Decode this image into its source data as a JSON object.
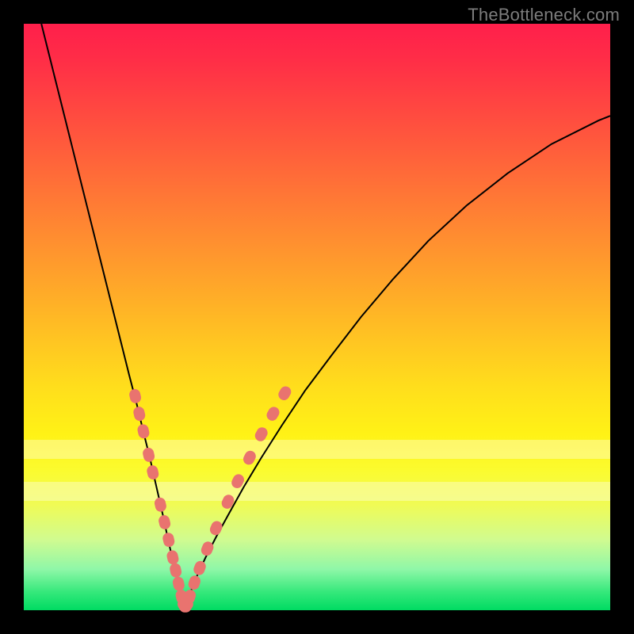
{
  "watermark": "TheBottleneck.com",
  "colors": {
    "bead": "#e9736f",
    "curve": "#000000",
    "frame": "#000000"
  },
  "chart_data": {
    "type": "line",
    "title": "",
    "xlabel": "",
    "ylabel": "",
    "xlim": [
      0,
      100
    ],
    "ylim": [
      0,
      100
    ],
    "grid": false,
    "legend": false,
    "note": "Two black curves forming a V-minimum over a vertical red→yellow→green gradient. Salmon beads mark where each curve passes through the pale band near the bottom. Values are approximate pixel-to-percent readings off the 740×740 plot area (0,0 at bottom-left).",
    "series": [
      {
        "name": "left-curve",
        "x": [
          3,
          5,
          7,
          9,
          11,
          13,
          15,
          16.5,
          18,
          19.3,
          20.5,
          21.5,
          22.4,
          23.2,
          24,
          24.6,
          25.2,
          25.7,
          26.1,
          26.4,
          26.7,
          26.95,
          27.15,
          27.3,
          27.4
        ],
        "y": [
          100,
          92,
          84,
          76,
          68,
          60,
          52,
          46,
          40,
          35,
          30,
          26,
          22,
          18.5,
          15,
          12,
          9.5,
          7.3,
          5.5,
          4,
          2.8,
          1.8,
          1.1,
          0.5,
          0.1
        ]
      },
      {
        "name": "right-curve",
        "x": [
          27.4,
          27.9,
          28.6,
          29.6,
          31,
          32.8,
          35,
          37.5,
          40.5,
          44,
          48,
          52.5,
          57.5,
          63,
          69,
          75.5,
          82.5,
          90,
          98,
          100
        ],
        "y": [
          0.1,
          1.5,
          3.5,
          6,
          9,
          12.5,
          16.5,
          21,
          26,
          31.5,
          37.5,
          43.5,
          50,
          56.5,
          63,
          69,
          74.5,
          79.5,
          83.5,
          84.3
        ]
      }
    ],
    "markers": {
      "name": "beads",
      "color": "#e9736f",
      "points": [
        {
          "x": 19.0,
          "y": 36.5
        },
        {
          "x": 19.7,
          "y": 33.5
        },
        {
          "x": 20.4,
          "y": 30.5
        },
        {
          "x": 21.3,
          "y": 26.5
        },
        {
          "x": 22.0,
          "y": 23.5
        },
        {
          "x": 23.3,
          "y": 18.0
        },
        {
          "x": 24.0,
          "y": 15.0
        },
        {
          "x": 24.7,
          "y": 12.0
        },
        {
          "x": 25.4,
          "y": 9.0
        },
        {
          "x": 25.9,
          "y": 6.8
        },
        {
          "x": 26.4,
          "y": 4.5
        },
        {
          "x": 26.9,
          "y": 2.3
        },
        {
          "x": 27.3,
          "y": 0.8
        },
        {
          "x": 27.8,
          "y": 0.8
        },
        {
          "x": 28.3,
          "y": 2.3
        },
        {
          "x": 29.1,
          "y": 4.7
        },
        {
          "x": 30.0,
          "y": 7.2
        },
        {
          "x": 31.3,
          "y": 10.5
        },
        {
          "x": 32.8,
          "y": 14.0
        },
        {
          "x": 34.8,
          "y": 18.5
        },
        {
          "x": 36.5,
          "y": 22.0
        },
        {
          "x": 38.5,
          "y": 26.0
        },
        {
          "x": 40.5,
          "y": 30.0
        },
        {
          "x": 42.5,
          "y": 33.5
        },
        {
          "x": 44.5,
          "y": 37.0
        }
      ]
    },
    "bands": [
      {
        "name": "pale-band-1",
        "y_from": 26,
        "y_to": 29,
        "opacity": 0.35
      },
      {
        "name": "pale-band-2",
        "y_from": 19,
        "y_to": 22,
        "opacity": 0.35
      }
    ]
  }
}
